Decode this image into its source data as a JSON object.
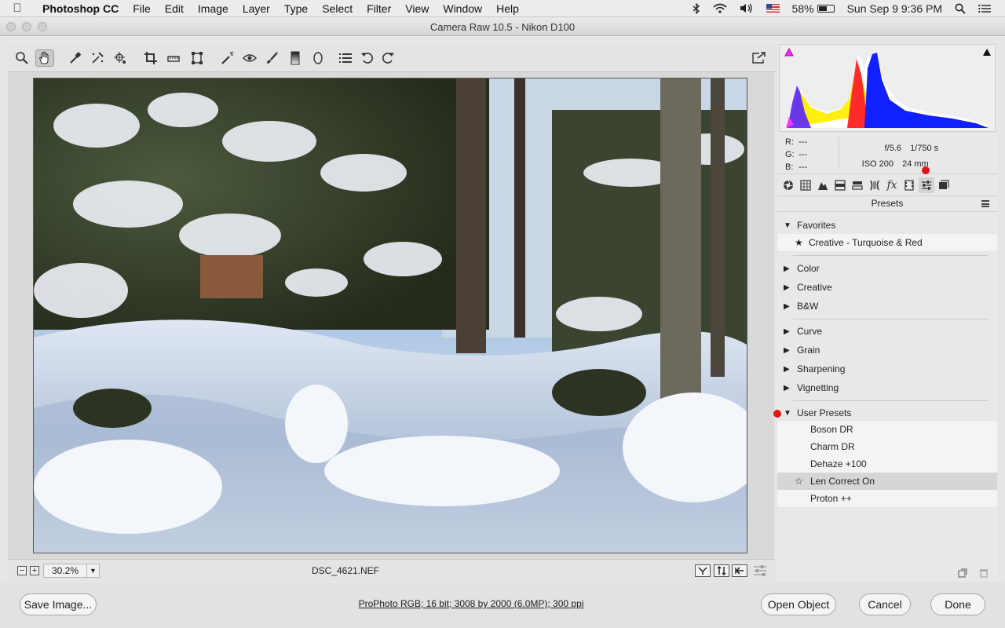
{
  "menubar": {
    "app_name": "Photoshop CC",
    "items": [
      "File",
      "Edit",
      "Image",
      "Layer",
      "Type",
      "Select",
      "Filter",
      "View",
      "Window",
      "Help"
    ],
    "battery": "58%",
    "datetime": "Sun Sep 9  9:36 PM"
  },
  "window": {
    "title": "Camera Raw 10.5  -  Nikon D100"
  },
  "info": {
    "r_label": "R:",
    "r_value": "---",
    "g_label": "G:",
    "g_value": "---",
    "b_label": "B:",
    "b_value": "---",
    "aperture": "f/5.6",
    "shutter": "1/750 s",
    "iso": "ISO 200",
    "focal": "24 mm"
  },
  "presets": {
    "header": "Presets",
    "favorites": "Favorites",
    "favorite_item": "Creative - Turquoise & Red",
    "groups": [
      "Color",
      "Creative",
      "B&W",
      "Curve",
      "Grain",
      "Sharpening",
      "Vignetting"
    ],
    "user_presets": "User Presets",
    "user_items": [
      "Boson DR",
      "Charm DR",
      "Dehaze +100",
      "Len Correct On",
      "Proton ++"
    ]
  },
  "preview": {
    "zoom": "30.2%",
    "filename": "DSC_4621.NEF"
  },
  "bottom": {
    "save_label": "Save Image...",
    "workflow": "ProPhoto RGB; 16 bit; 3008 by 2000 (6.0MP); 300 ppi",
    "open_label": "Open Object",
    "cancel_label": "Cancel",
    "done_label": "Done"
  },
  "colors": {
    "accent_red": "#e21414",
    "histogram_red": "#ff2a2a",
    "histogram_yellow": "#ffee00",
    "histogram_blue": "#1020ff"
  }
}
